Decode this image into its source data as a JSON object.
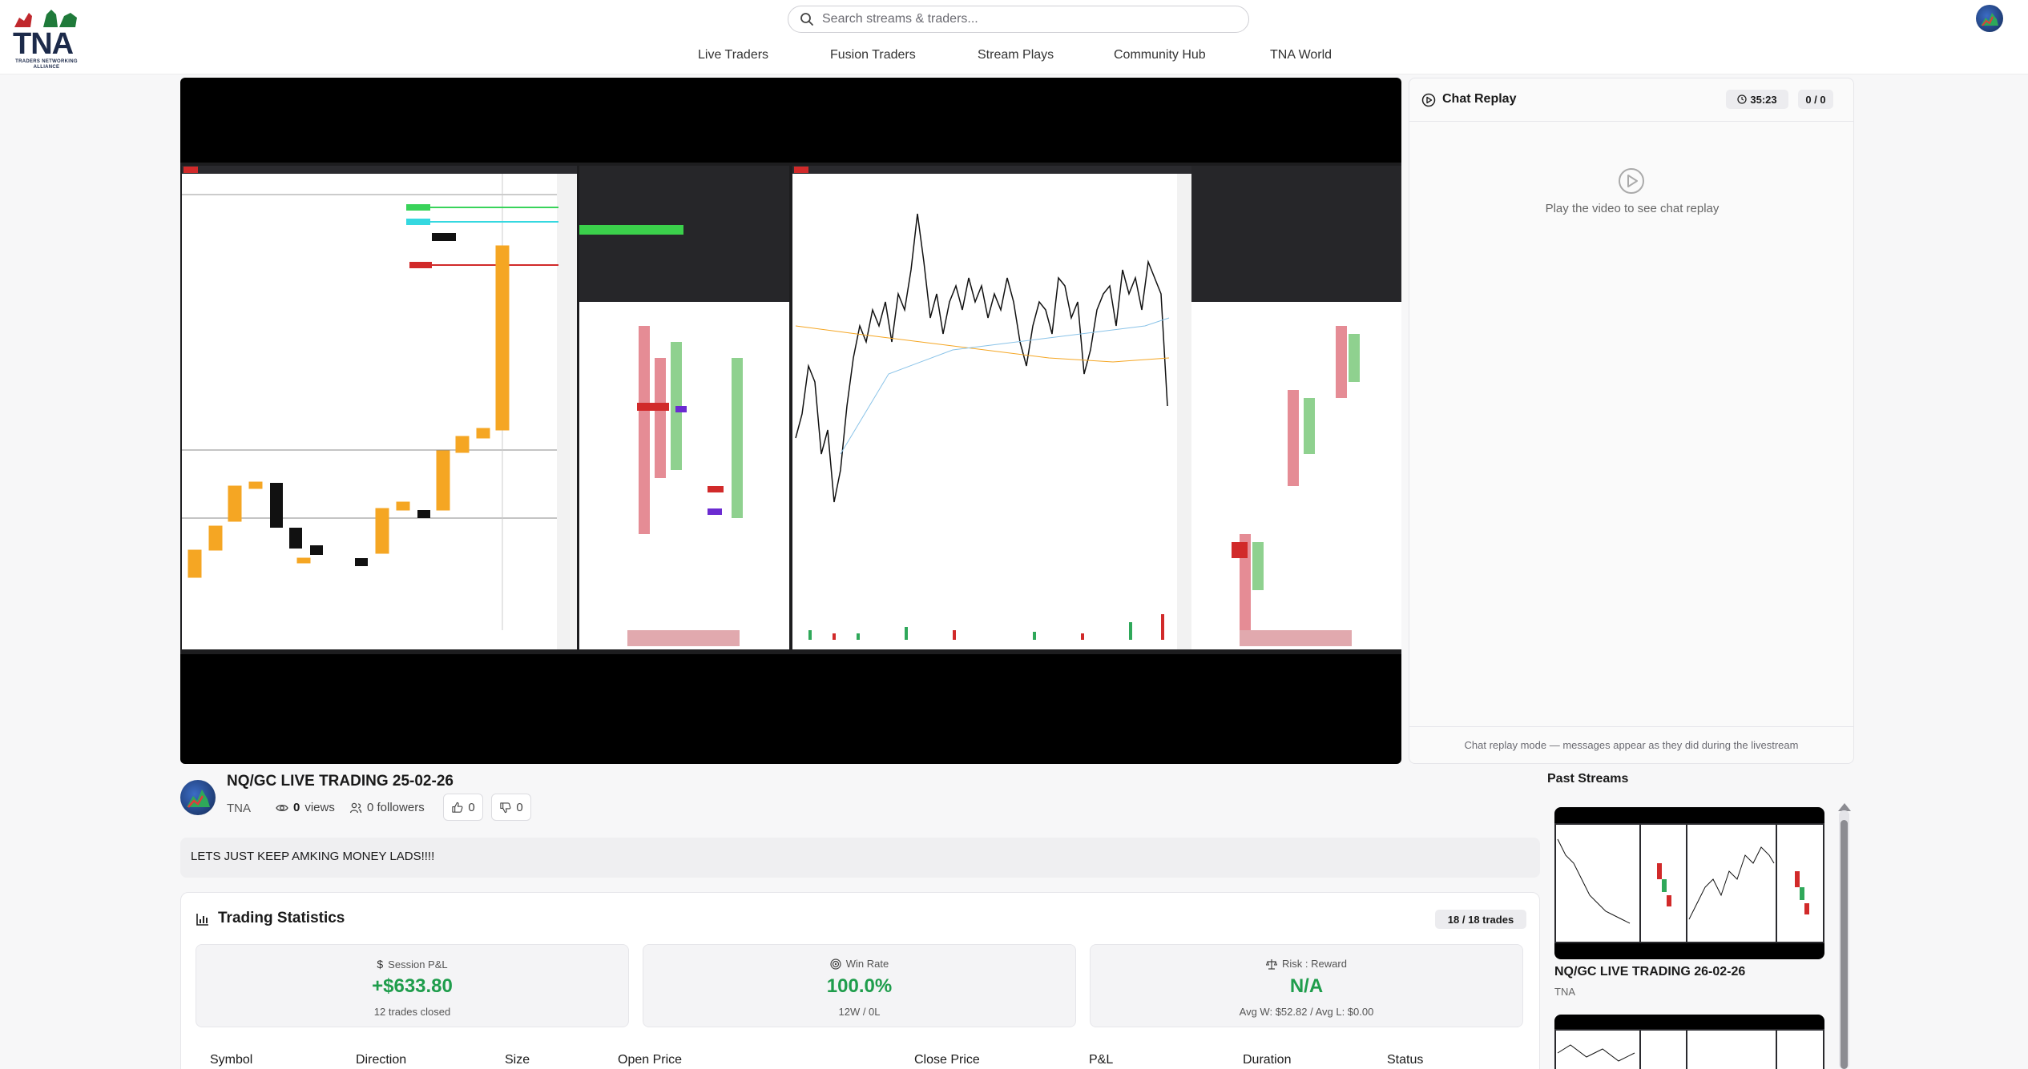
{
  "header": {
    "logo_text": "TNA",
    "logo_tagline": "TRADERS NETWORKING ALLIANCE",
    "search_placeholder": "Search streams & traders...",
    "nav": [
      {
        "label": "Live Traders"
      },
      {
        "label": "Fusion Traders"
      },
      {
        "label": "Stream Plays"
      },
      {
        "label": "Community Hub"
      },
      {
        "label": "TNA World"
      }
    ]
  },
  "chat": {
    "title": "Chat Replay",
    "timer": "35:23",
    "count": "0 / 0",
    "empty_text": "Play the video to see chat replay",
    "footer": "Chat replay mode — messages appear as they did during the livestream"
  },
  "stream": {
    "title": "NQ/GC LIVE TRADING 25-02-26",
    "streamer": "TNA",
    "views": "0",
    "views_label": "views",
    "followers": "0 followers",
    "likes": "0",
    "dislikes": "0",
    "description": "LETS JUST KEEP AMKING MONEY LADS!!!!"
  },
  "trading_stats": {
    "title": "Trading Statistics",
    "trades_badge": "18 / 18 trades",
    "cards": [
      {
        "label": "Session P&L",
        "value": "+$633.80",
        "sub": "12 trades closed",
        "icon": "dollar-icon"
      },
      {
        "label": "Win Rate",
        "value": "100.0%",
        "sub": "12W / 0L",
        "icon": "target-icon"
      },
      {
        "label": "Risk : Reward",
        "value": "N/A",
        "sub": "Avg W: $52.82 / Avg L: $0.00",
        "icon": "scale-icon"
      }
    ],
    "columns": [
      "Symbol",
      "Direction",
      "Size",
      "Open Price",
      "Close Price",
      "P&L",
      "Duration",
      "Status"
    ]
  },
  "past_streams": {
    "title": "Past Streams",
    "items": [
      {
        "title": "NQ/GC LIVE TRADING 26-02-26",
        "streamer": "TNA"
      }
    ]
  },
  "colors": {
    "accent_green": "#1f9d4c",
    "video_bg": "#000000"
  }
}
